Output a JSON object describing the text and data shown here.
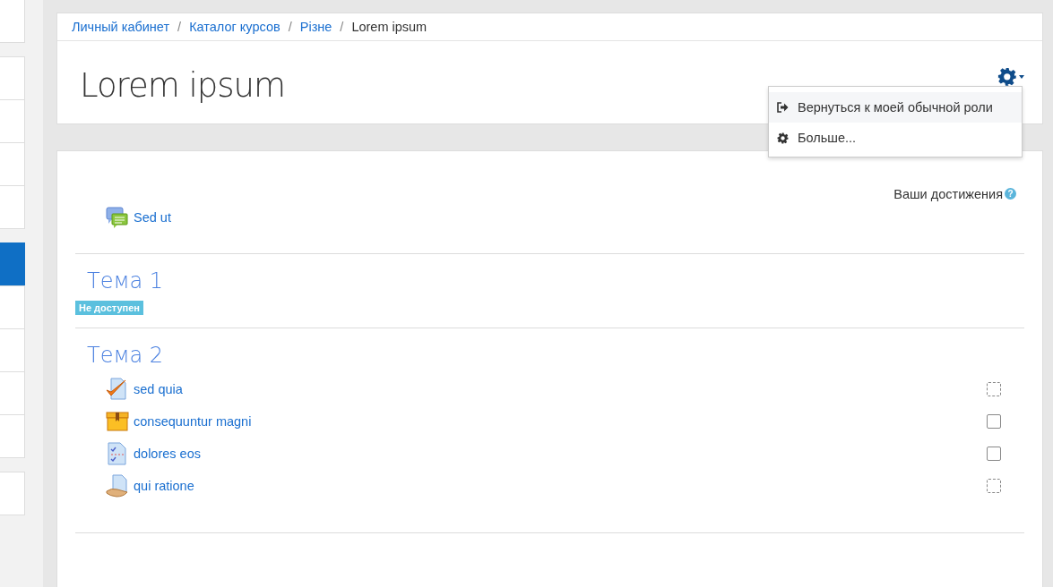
{
  "sidebar": {
    "groups": [
      [
        {
          "selected": false
        }
      ],
      [
        {
          "selected": false
        },
        {
          "selected": false
        },
        {
          "selected": false
        },
        {
          "selected": false
        }
      ],
      [
        {
          "selected": true
        },
        {
          "selected": false
        },
        {
          "selected": false
        },
        {
          "selected": false
        },
        {
          "selected": false
        }
      ],
      [
        {
          "selected": false
        }
      ]
    ]
  },
  "breadcrumb": [
    {
      "label": "Личный кабинет",
      "kind": "link"
    },
    {
      "label": "/",
      "kind": "separator"
    },
    {
      "label": "Каталог курсов",
      "kind": "link"
    },
    {
      "label": "/",
      "kind": "separator"
    },
    {
      "label": "Різне",
      "kind": "link"
    },
    {
      "label": "/",
      "kind": "separator"
    },
    {
      "label": "Lorem ipsum",
      "kind": "current"
    }
  ],
  "page_title": "Lorem ipsum",
  "actions_menu": {
    "expanded": true,
    "items": [
      {
        "label": "Вернуться к моей обычной роли",
        "kind": "return",
        "selected": true
      },
      {
        "label": "Больше...",
        "kind": "gear",
        "selected": false
      }
    ]
  },
  "progress_label": "Ваши достижения",
  "help_icon": "?",
  "intro_activities": [
    {
      "name": "Sed ut",
      "kind": "forum"
    }
  ],
  "sections": [
    {
      "title": "Тема 1",
      "badge": "Не доступен"
    },
    {
      "title": "Тема 2",
      "activities": [
        {
          "name": "sed quia",
          "kind": "assign",
          "automatic": true
        },
        {
          "name": "consequuntur magni",
          "kind": "box",
          "automatic": false
        },
        {
          "name": "dolores eos",
          "kind": "quiz",
          "automatic": false
        },
        {
          "name": "qui ratione",
          "kind": "resource",
          "automatic": true
        }
      ]
    }
  ]
}
